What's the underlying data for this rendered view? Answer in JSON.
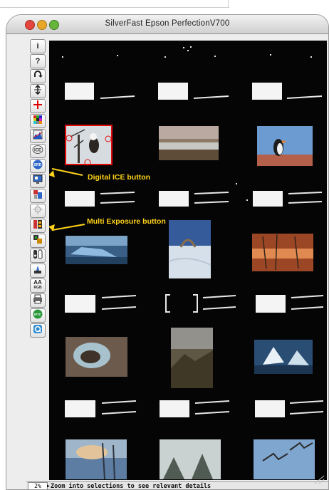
{
  "window": {
    "title": "SilverFast Epson PerfectionV700"
  },
  "toolbar": {
    "info_label": "i",
    "help_label": "?",
    "aa_label": "AA",
    "aa_sub": "RGB",
    "ice_label": "ICE",
    "srd_label": "SRD",
    "iptc_label": "IPTC"
  },
  "annotations": {
    "ice": "Digital ICE button",
    "multi_exposure": "Multi Exposure button"
  },
  "status": {
    "zoom": "2%",
    "hint": "Zoom into selections to see relevant details"
  },
  "colors": {
    "annotation": "#ffd319",
    "selection": "#e10a0a",
    "canvas": "#050505"
  }
}
